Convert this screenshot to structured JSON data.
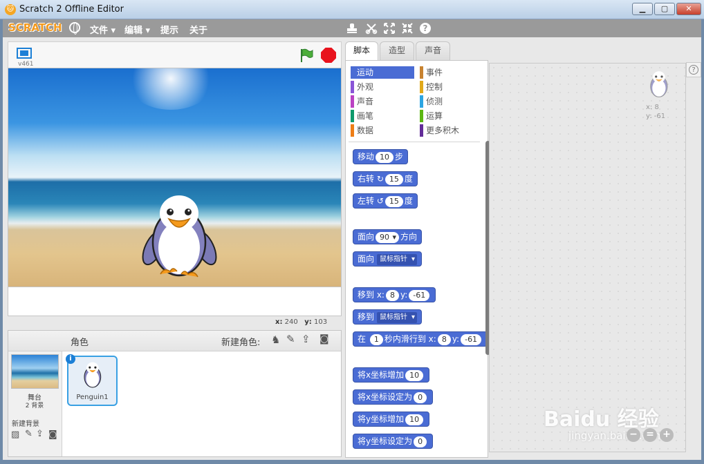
{
  "window": {
    "title": "Scratch 2 Offline Editor",
    "min": "▁",
    "max": "▢",
    "close": "✕"
  },
  "menubar": {
    "logo": "SCRATCH",
    "items": [
      "文件 ▾",
      "编辑 ▾",
      "提示",
      "关于"
    ]
  },
  "stage": {
    "version": "v461",
    "mouse_x_label": "x:",
    "mouse_x": "240",
    "mouse_y_label": "y:",
    "mouse_y": "103"
  },
  "sprites": {
    "header_label": "角色",
    "new_sprite_label": "新建角色:",
    "stage_label": "舞台",
    "stage_backdrops": "2 背景",
    "new_backdrop_label": "新建背景",
    "sprite_name": "Penguin1",
    "info_icon": "i"
  },
  "tabs": [
    "脚本",
    "造型",
    "声音"
  ],
  "categories": {
    "left": [
      {
        "label": "运动",
        "color": "#4a6cd4"
      },
      {
        "label": "外观",
        "color": "#8a55d7"
      },
      {
        "label": "声音",
        "color": "#bb42c3"
      },
      {
        "label": "画笔",
        "color": "#0e9a6c"
      },
      {
        "label": "数据",
        "color": "#ee7d16"
      }
    ],
    "right": [
      {
        "label": "事件",
        "color": "#c88330"
      },
      {
        "label": "控制",
        "color": "#e1a91a"
      },
      {
        "label": "侦测",
        "color": "#2ca5e2"
      },
      {
        "label": "运算",
        "color": "#5cb712"
      },
      {
        "label": "更多积木",
        "color": "#632d99"
      }
    ]
  },
  "blocks": {
    "move": {
      "a": "移动",
      "v": "10",
      "b": "步"
    },
    "turn_right": {
      "a": "右转",
      "icon": "↻",
      "v": "15",
      "b": "度"
    },
    "turn_left": {
      "a": "左转",
      "icon": "↺",
      "v": "15",
      "b": "度"
    },
    "point_dir": {
      "a": "面向",
      "v": "90",
      "b": "方向"
    },
    "point_towards": {
      "a": "面向",
      "v": "鼠标指针"
    },
    "goto_xy": {
      "a": "移到 x:",
      "x": "8",
      "b": "y:",
      "y": "-61"
    },
    "goto": {
      "a": "移到",
      "v": "鼠标指针"
    },
    "glide": {
      "a": "在",
      "secs": "1",
      "b": "秒内滑行到 x:",
      "x": "8",
      "c": "y:",
      "y": "-61"
    },
    "change_x": {
      "a": "将x坐标增加",
      "v": "10"
    },
    "set_x": {
      "a": "将x坐标设定为",
      "v": "0"
    },
    "change_y": {
      "a": "将y坐标增加",
      "v": "10"
    },
    "set_y": {
      "a": "将y坐标设定为",
      "v": "0"
    }
  },
  "script_area": {
    "x_label": "x: 8",
    "y_label": "y: -61",
    "help": "?",
    "zoom_out": "−",
    "zoom_reset": "=",
    "zoom_in": "+"
  },
  "watermark": {
    "brand": "Baidu 经验",
    "sub": "jingyan.baidu.com"
  },
  "colors": {
    "motion": "#4a6cd4",
    "menubar": "#9a9a9a",
    "selection": "#38a0e3"
  }
}
